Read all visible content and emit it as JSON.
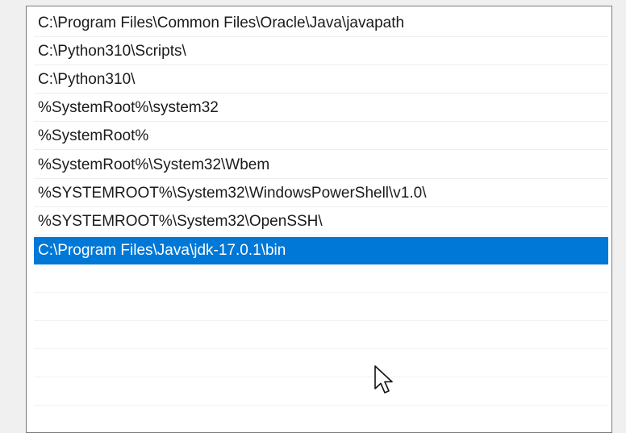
{
  "path_list": {
    "items": [
      "C:\\Program Files\\Common Files\\Oracle\\Java\\javapath",
      "C:\\Python310\\Scripts\\",
      "C:\\Python310\\",
      "%SystemRoot%\\system32",
      "%SystemRoot%",
      "%SystemRoot%\\System32\\Wbem",
      "%SYSTEMROOT%\\System32\\WindowsPowerShell\\v1.0\\",
      "%SYSTEMROOT%\\System32\\OpenSSH\\",
      "C:\\Program Files\\Java\\jdk-17.0.1\\bin"
    ],
    "selected_index": 8
  },
  "colors": {
    "selection": "#0078d7",
    "text": "#1b1b1b",
    "background": "#ffffff"
  },
  "cursor": {
    "icon": "arrow-cursor-icon"
  }
}
